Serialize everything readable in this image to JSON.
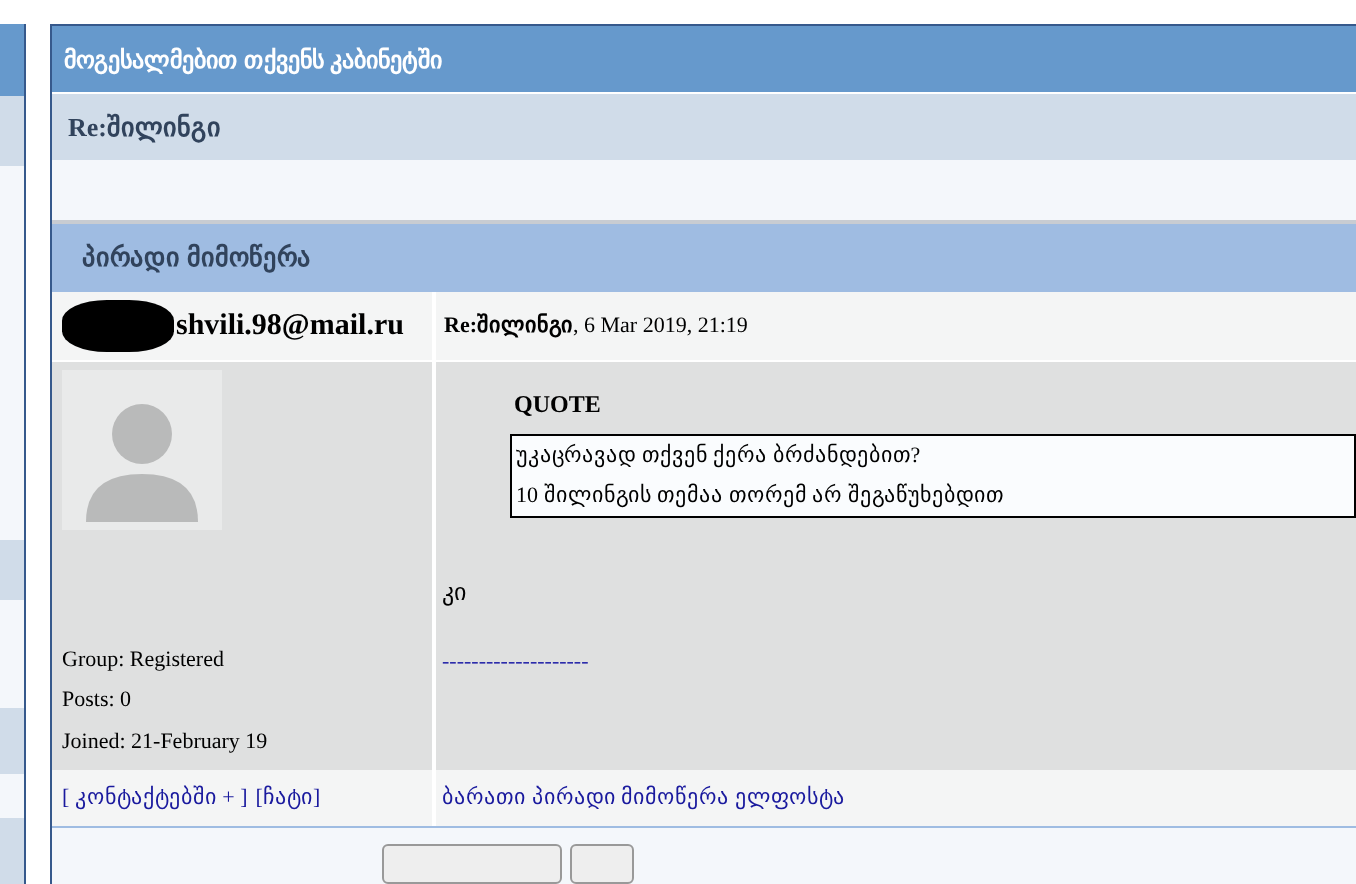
{
  "page_title": "მოგესალმებით თქვენს კაბინეტში",
  "topic_title": "Re:შილინგი",
  "section_title": "პირადი მიმოწერა",
  "message": {
    "sender_email": "shvili.98@mail.ru",
    "subject": "Re:შილინგი",
    "date": ", 6 Mar 2019, 21:19",
    "quote_label": "QUOTE",
    "quote_lines": [
      "უკაცრავად თქვენ ქერა ბრძანდებით?",
      "10 შილინგის თემაა თორემ არ შეგაწუხებდით"
    ],
    "body": "კი",
    "signature": "--------------------",
    "user_info": [
      "Group: Registered",
      "Posts: 0",
      "Joined: 21-February 19"
    ],
    "contact_links": [
      "[ კონტაქტებში + ]",
      "[ჩატი]"
    ],
    "footer_link": "ბარათი პირადი მიმოწერა ელფოსტა"
  }
}
